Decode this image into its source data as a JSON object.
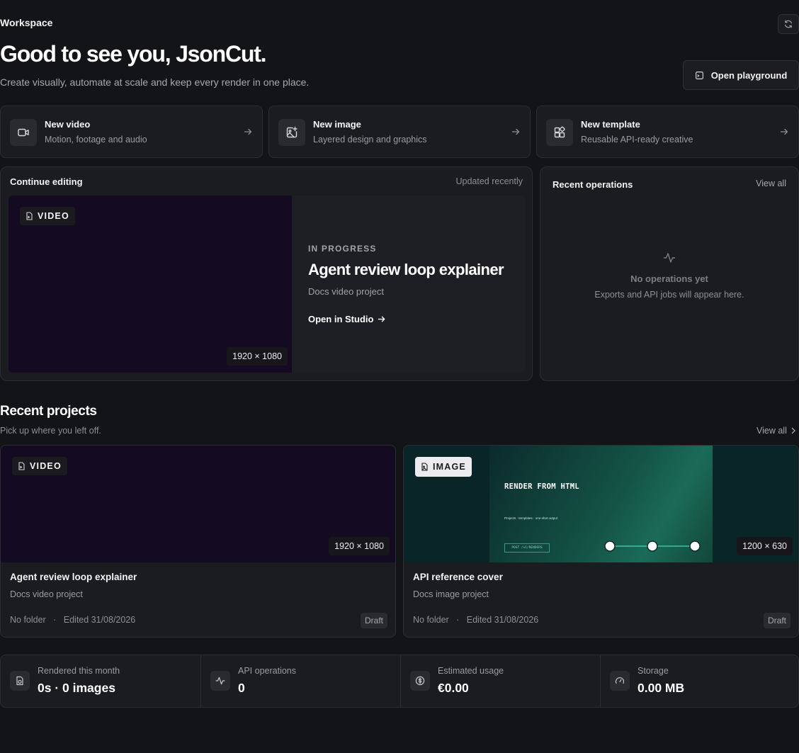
{
  "header": {
    "workspace_label": "Workspace",
    "greeting": "Good to see you, JsonCut.",
    "subtitle": "Create visually, automate at scale and keep every render in one place.",
    "playground_label": "Open playground",
    "refresh_icon": "refresh-icon"
  },
  "quick_actions": [
    {
      "title": "New video",
      "desc": "Motion, footage and audio",
      "icon": "video-camera-icon"
    },
    {
      "title": "New image",
      "desc": "Layered design and graphics",
      "icon": "image-plus-icon"
    },
    {
      "title": "New template",
      "desc": "Reusable API-ready creative",
      "icon": "template-icon"
    }
  ],
  "continue_editing": {
    "title": "Continue editing",
    "updated": "Updated recently",
    "badge": "VIDEO",
    "dims": "1920 × 1080",
    "status": "IN PROGRESS",
    "name": "Agent review loop explainer",
    "sub": "Docs video project",
    "open_label": "Open in Studio"
  },
  "recent_operations": {
    "title": "Recent operations",
    "view_all": "View all",
    "empty_title": "No operations yet",
    "empty_desc": "Exports and API jobs will appear here."
  },
  "recent_projects": {
    "title": "Recent projects",
    "subtitle": "Pick up where you left off.",
    "view_all": "View all",
    "items": [
      {
        "badge": "VIDEO",
        "dims": "1920 × 1080",
        "name": "Agent review loop explainer",
        "sub": "Docs video project",
        "folder": "No folder",
        "edited": "Edited 31/08/2026",
        "status": "Draft"
      },
      {
        "badge": "IMAGE",
        "dims": "1200 × 630",
        "name": "API reference cover",
        "sub": "Docs image project",
        "folder": "No folder",
        "edited": "Edited 31/08/2026",
        "status": "Draft",
        "thumb_heading": "RENDER FROM HTML",
        "thumb_sub": "Projects · templates · one-shot output",
        "thumb_tag": "POST /v1/RENDERS"
      }
    ]
  },
  "stats": [
    {
      "label": "Rendered this month",
      "value": "0s · 0 images",
      "icon": "render-file-icon"
    },
    {
      "label": "API operations",
      "value": "0",
      "icon": "activity-icon"
    },
    {
      "label": "Estimated usage",
      "value": "€0.00",
      "icon": "dollar-circle-icon"
    },
    {
      "label": "Storage",
      "value": "0.00 MB",
      "icon": "gauge-icon"
    }
  ],
  "colors": {
    "background": "#131417",
    "card": "#1b1c20",
    "border": "#2b2d33",
    "video_thumb": "#140b22",
    "accent_teal": "#2aa08a"
  }
}
